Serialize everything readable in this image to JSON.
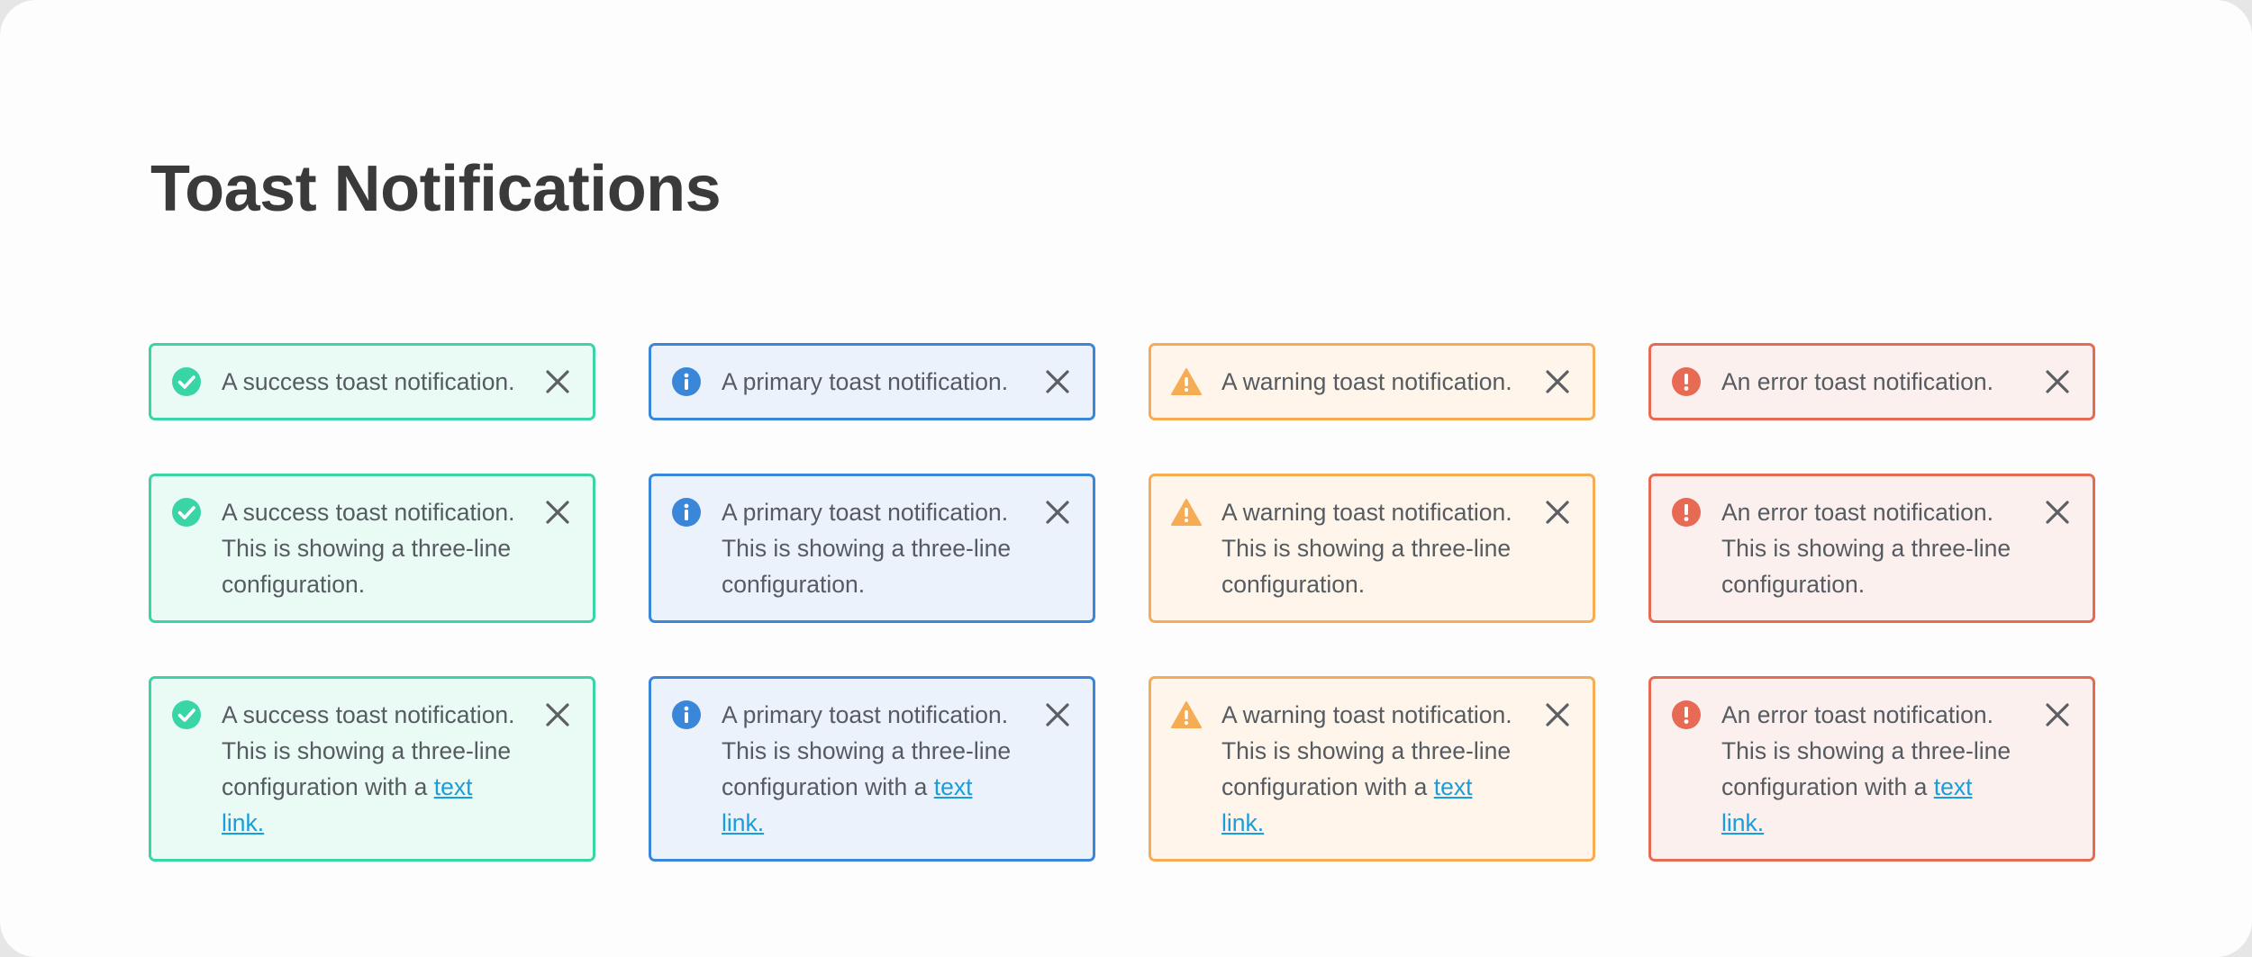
{
  "page": {
    "title": "Toast Notifications"
  },
  "colors": {
    "success": "#3ad5a6",
    "primary": "#3a87d9",
    "warning": "#f5ac55",
    "error": "#e76a55",
    "link": "#1a9dd9"
  },
  "icons": {
    "success": "check-circle-icon",
    "primary": "info-circle-icon",
    "warning": "warning-triangle-icon",
    "error": "exclamation-circle-icon",
    "close": "close-icon"
  },
  "toasts": {
    "single": {
      "success": "A success toast notification.",
      "primary": "A primary toast notification.",
      "warning": "A warning toast notification.",
      "error": "An error toast notification."
    },
    "three_line": {
      "success": "A success toast notification. This is showing a three-line configuration.",
      "primary": "A primary toast notification. This is showing a three-line configuration.",
      "warning": "A warning toast notification. This is showing a three-line configuration.",
      "error": "An error toast notification. This is showing a three-line configuration."
    },
    "with_link": {
      "success": "A success toast notification. This is showing a three-line configuration with a",
      "primary": "A primary toast notification. This is showing a three-line configuration with a",
      "warning": "A warning toast notification. This is showing a three-line configuration with a",
      "error": "An error toast notification. This is showing a three-line configuration with a",
      "link_label": "text link."
    }
  }
}
